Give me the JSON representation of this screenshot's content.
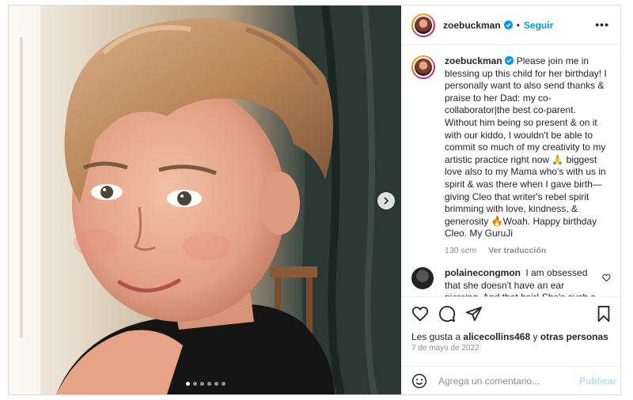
{
  "account": {
    "username": "zoebuckman"
  },
  "header": {
    "separator": "•",
    "follow_label": "Seguir",
    "more_glyph": "•••"
  },
  "caption": {
    "username": "zoebuckman",
    "text": "Please join me in blessing up this child for her birthday! I personally want to also send thanks & praise to her Dad: my co-collaborator|the best co-parent. Without him being so present & on it with our kiddo, I wouldn't be able to commit so much of my creativity to my artistic practice right now 🙏 biggest love also to my Mama who's with us in spirit & was there when I gave birth— giving Cleo that writer's rebel spirit brimming with love, kindness, & generosity 🔥Woah. Happy birthday Cleo. My GuruJi",
    "age": "130 sem",
    "translate_label": "Ver traducción"
  },
  "comment": {
    "username": "polainecongmon",
    "text": "I am obsessed that she doesn't have an ear piercing. And that hair! She's such a"
  },
  "likes": {
    "prefix": "Les gusta a",
    "user": "alicecollins468",
    "connector": "y",
    "others": "otras personas"
  },
  "date": "7 de mayo de 2022",
  "add_comment": {
    "placeholder": "Agrega un comentario...",
    "publish_label": "Publicar"
  },
  "carousel": {
    "total_slides": 6,
    "active_index": 0
  },
  "colors": {
    "accent": "#0095f6",
    "publish_disabled": "#b2dffc",
    "muted": "#8e8e8e",
    "verified": "#0095f6"
  },
  "icons": [
    "chevron-right-icon",
    "verified-icon",
    "more-icon",
    "heart-icon",
    "comment-icon",
    "share-icon",
    "bookmark-icon",
    "emoji-icon"
  ]
}
